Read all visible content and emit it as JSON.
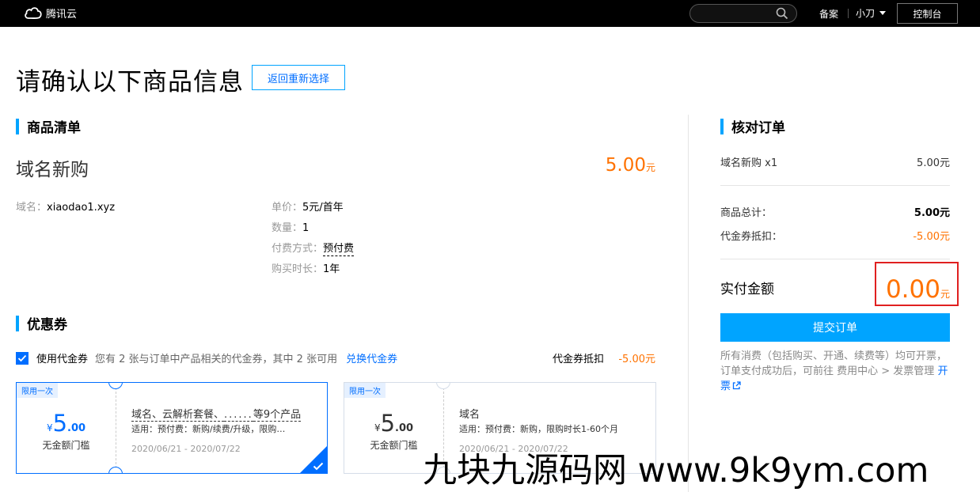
{
  "topbar": {
    "logo_text": "腾讯云",
    "beian": "备案",
    "user": "小刀",
    "console": "控制台"
  },
  "page": {
    "title": "请确认以下商品信息",
    "back_button": "返回重新选择"
  },
  "product_list": {
    "section_title": "商品清单",
    "name": "域名新购",
    "price": "5.00",
    "price_unit": "元",
    "domain_label": "域名：",
    "domain_value": "xiaodao1.xyz",
    "unit_price_label": "单价：",
    "unit_price_value": "5元/首年",
    "qty_label": "数量：",
    "qty_value": "1",
    "pay_method_label": "付费方式：",
    "pay_method_value": "预付费",
    "duration_label": "购买时长：",
    "duration_value": "1年"
  },
  "coupons": {
    "section_title": "优惠券",
    "use_label": "使用代金券",
    "desc": "您有 2 张与订单中产品相关的代金券，其中 2 张可用",
    "redeem_link": "兑换代金券",
    "deduct_label": "代金券抵扣",
    "deduct_value": "-5.00元",
    "items": [
      {
        "tag": "限用一次",
        "currency": "¥",
        "amount_int": "5",
        "amount_dec": ".00",
        "threshold": "无金额门槛",
        "title_a": "域名、云解析套餐、",
        "title_b": "等9个产品",
        "scope": "适用：预付费：新购/续费/升级，限购…",
        "date": "2020/06/21 - 2020/07/22",
        "selected": true
      },
      {
        "tag": "限用一次",
        "currency": "¥",
        "amount_int": "5",
        "amount_dec": ".00",
        "threshold": "无金额门槛",
        "title_a": "域名",
        "title_b": "",
        "scope": "适用：预付费：新购，限购时长1-60个月",
        "date": "2020/06/21 - 2020/07/22",
        "selected": false
      }
    ]
  },
  "order_check": {
    "section_title": "核对订单",
    "item_label": "域名新购 x1",
    "item_value": "5.00元",
    "total_label": "商品总计：",
    "total_value": "5.00元",
    "coupon_label": "代金券抵扣：",
    "coupon_value": "-5.00元",
    "pay_label": "实付金额",
    "pay_amount": "0.00",
    "pay_unit": "元",
    "submit": "提交订单",
    "note_text": "所有消费（包括购买、开通、续费等）均可开票，订单支付成功后，可前往 费用中心 > 发票管理",
    "note_link": "开票"
  },
  "watermark": "九块九源码网 www.9k9ym.com",
  "colors": {
    "accent": "#00a4ff",
    "link": "#006eff",
    "price": "#ff7200",
    "highlight_box": "#e02020"
  }
}
